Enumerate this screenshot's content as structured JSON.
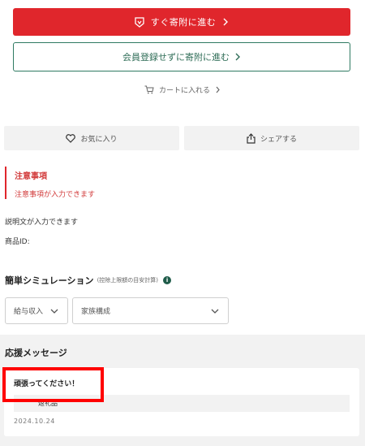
{
  "actions": {
    "donate_label": "すぐ寄附に進む",
    "donate_without_register_label": "会員登録せずに寄附に進む",
    "cart_label": "カートに入れる"
  },
  "social": {
    "favorite_label": "お気に入り",
    "share_label": "シェアする"
  },
  "notice": {
    "title": "注意事項",
    "text": "注意事項が入力できます"
  },
  "details": {
    "description": "説明文が入力できます",
    "product_id_label": "商品ID:"
  },
  "simulation": {
    "title": "簡単シミュレーション",
    "subtitle": "(控除上限額の目安計算)",
    "info_icon": "i",
    "income_select": "給与収入",
    "family_select": "家族構成"
  },
  "support": {
    "title": "応援メッセージ",
    "message": "頑張ってください！",
    "product": "返礼品",
    "date": "2024.10.24"
  },
  "colors": {
    "primary": "#e0262c",
    "outline": "#2f7a62",
    "highlight": "#ff0000"
  }
}
